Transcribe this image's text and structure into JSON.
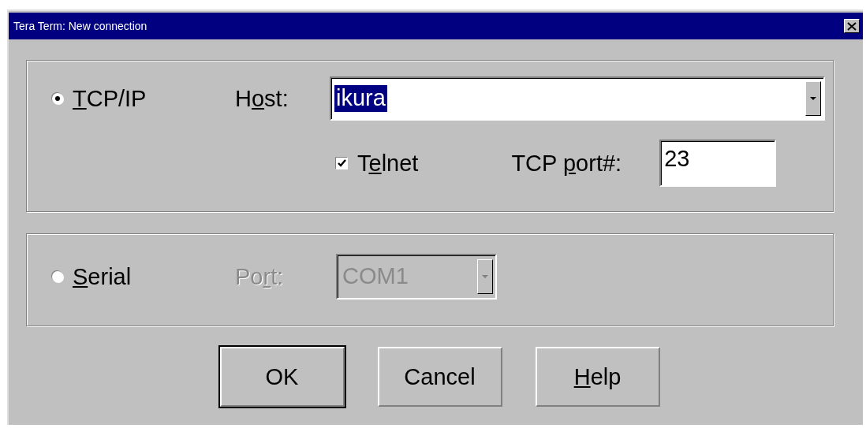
{
  "window": {
    "title": "Tera Term: New connection"
  },
  "tcpip": {
    "radio": {
      "label_parts": [
        {
          "text": "T",
          "underlined": true
        },
        {
          "text": "CP/IP",
          "underlined": false
        }
      ],
      "selected": true
    },
    "host": {
      "label_parts": [
        {
          "text": "H",
          "underlined": false
        },
        {
          "text": "o",
          "underlined": true
        },
        {
          "text": "st:",
          "underlined": false
        }
      ],
      "value": "ikura",
      "text_selected": true
    },
    "telnet": {
      "label_parts": [
        {
          "text": "T",
          "underlined": false
        },
        {
          "text": "e",
          "underlined": true
        },
        {
          "text": "lnet",
          "underlined": false
        }
      ],
      "checked": true
    },
    "port": {
      "label_parts": [
        {
          "text": "TCP ",
          "underlined": false
        },
        {
          "text": "p",
          "underlined": true
        },
        {
          "text": "ort#:",
          "underlined": false
        }
      ],
      "value": "23"
    }
  },
  "serial": {
    "radio": {
      "label_parts": [
        {
          "text": "S",
          "underlined": true
        },
        {
          "text": "erial",
          "underlined": false
        }
      ],
      "selected": false
    },
    "port": {
      "label_parts": [
        {
          "text": "Po",
          "underlined": false
        },
        {
          "text": "r",
          "underlined": true
        },
        {
          "text": "t:",
          "underlined": false
        }
      ],
      "value": "COM1",
      "disabled": true
    }
  },
  "buttons": [
    {
      "label_parts": [
        {
          "text": "OK",
          "underlined": false
        }
      ],
      "default": true
    },
    {
      "label_parts": [
        {
          "text": "Cancel",
          "underlined": false
        }
      ],
      "default": false
    },
    {
      "label_parts": [
        {
          "text": "H",
          "underlined": true
        },
        {
          "text": "elp",
          "underlined": false
        }
      ],
      "default": false
    }
  ]
}
